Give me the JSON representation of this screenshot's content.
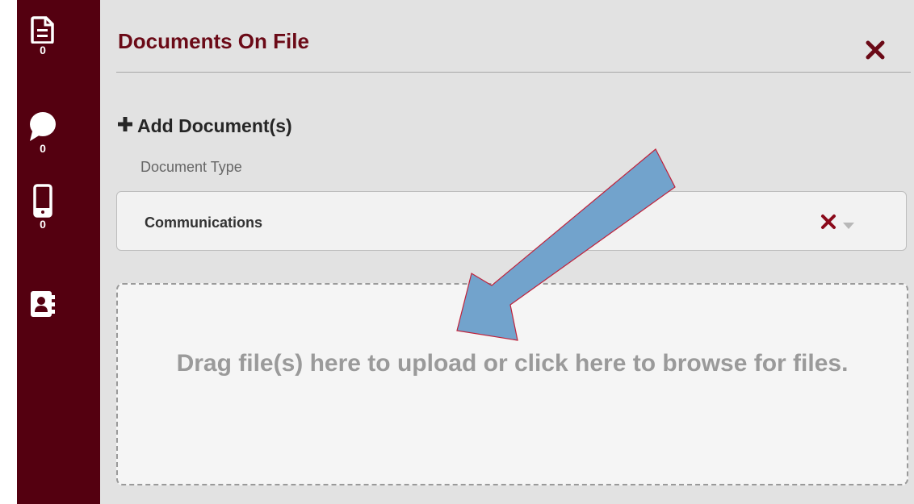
{
  "sidebar": {
    "items": [
      {
        "icon": "document-icon",
        "count": "0"
      },
      {
        "icon": "chat-bubble-icon",
        "count": "0"
      },
      {
        "icon": "mobile-phone-icon",
        "count": "0"
      },
      {
        "icon": "contact-book-icon"
      }
    ]
  },
  "panel": {
    "title": "Documents On File",
    "add_label": "Add Document(s)",
    "doc_type_label": "Document Type",
    "doc_type_value": "Communications",
    "dropzone_text": "Drag file(s) here to upload or click here to browse for files."
  },
  "colors": {
    "sidebar_bg": "#540010",
    "accent": "#6b0a17",
    "panel_bg": "#e2e2e2",
    "annotation_arrow_fill": "#72a3cc",
    "annotation_arrow_stroke": "#c0213a"
  }
}
